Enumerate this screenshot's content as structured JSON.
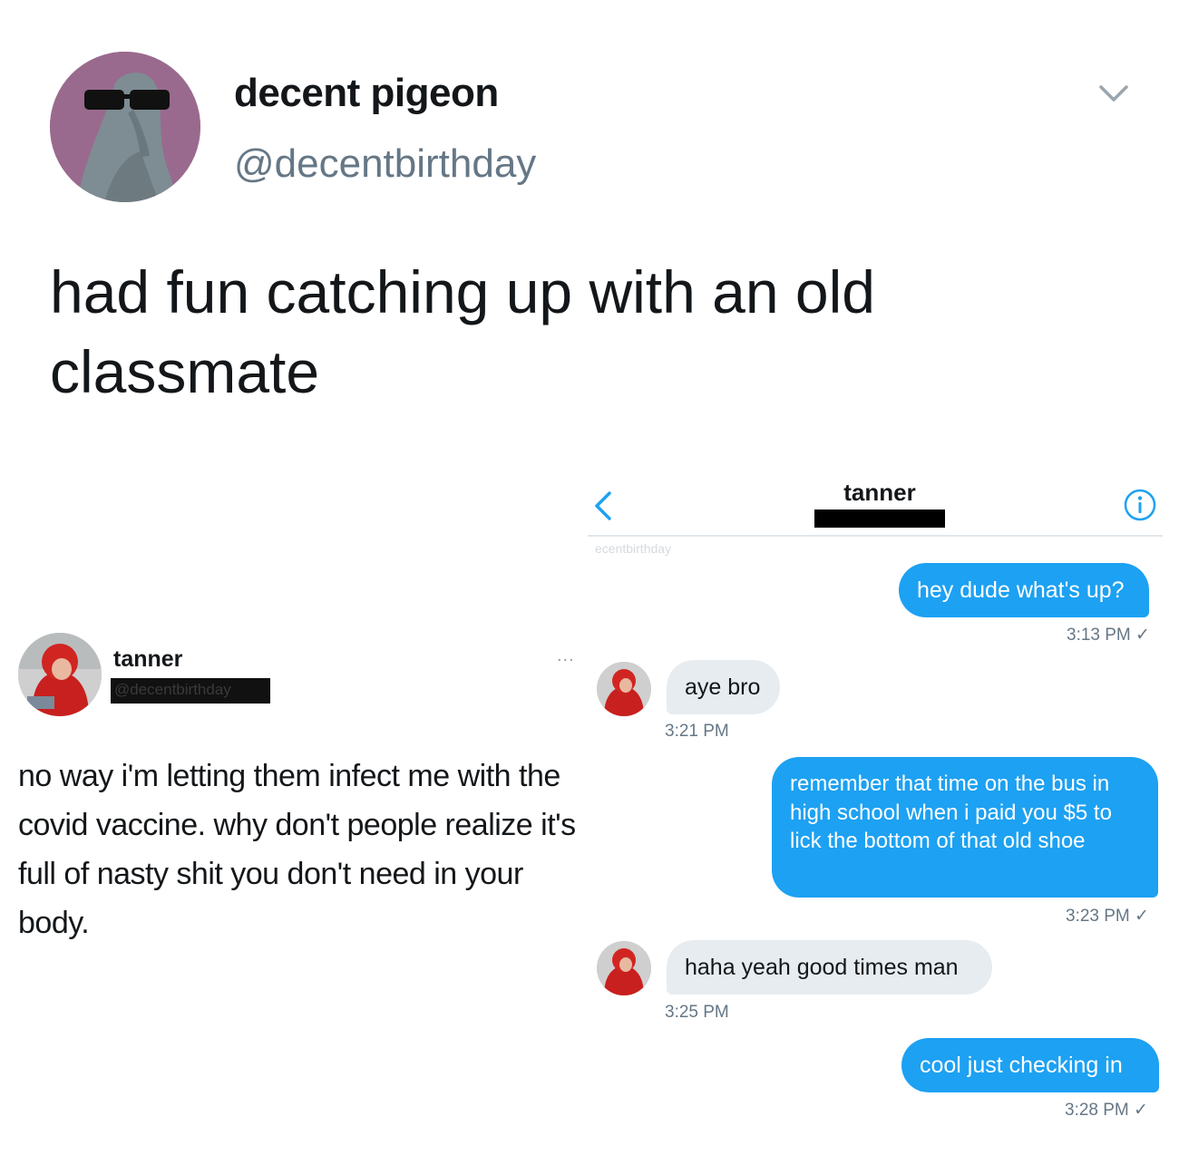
{
  "tweet": {
    "display_name": "decent pigeon",
    "handle": "@decentbirthday",
    "text": "had fun catching up with an old classmate"
  },
  "embedded_tweet": {
    "name": "tanner",
    "handle": "@decentbirthday",
    "more_menu": "...",
    "text": "no way i'm letting them infect me with the covid vaccine. why don't people realize it's full of nasty shit you don't need in your body."
  },
  "dm": {
    "contact_name": "tanner",
    "watermark": "ecentbirthday",
    "messages": [
      {
        "text": "hey dude what's up?",
        "time": "3:13 PM ✓"
      },
      {
        "text": "aye bro",
        "time": "3:21 PM"
      },
      {
        "text": "remember that time on the bus in high school when i paid you $5 to lick the bottom of that old shoe",
        "time": "3:23 PM ✓"
      },
      {
        "text": "haha yeah good times man",
        "time": "3:25 PM"
      },
      {
        "text": "cool just checking in",
        "time": "3:28 PM ✓"
      }
    ]
  },
  "colors": {
    "outgoing_bubble": "#1da1f2",
    "incoming_bubble": "#e6ecf0",
    "handle_gray": "#657786"
  }
}
